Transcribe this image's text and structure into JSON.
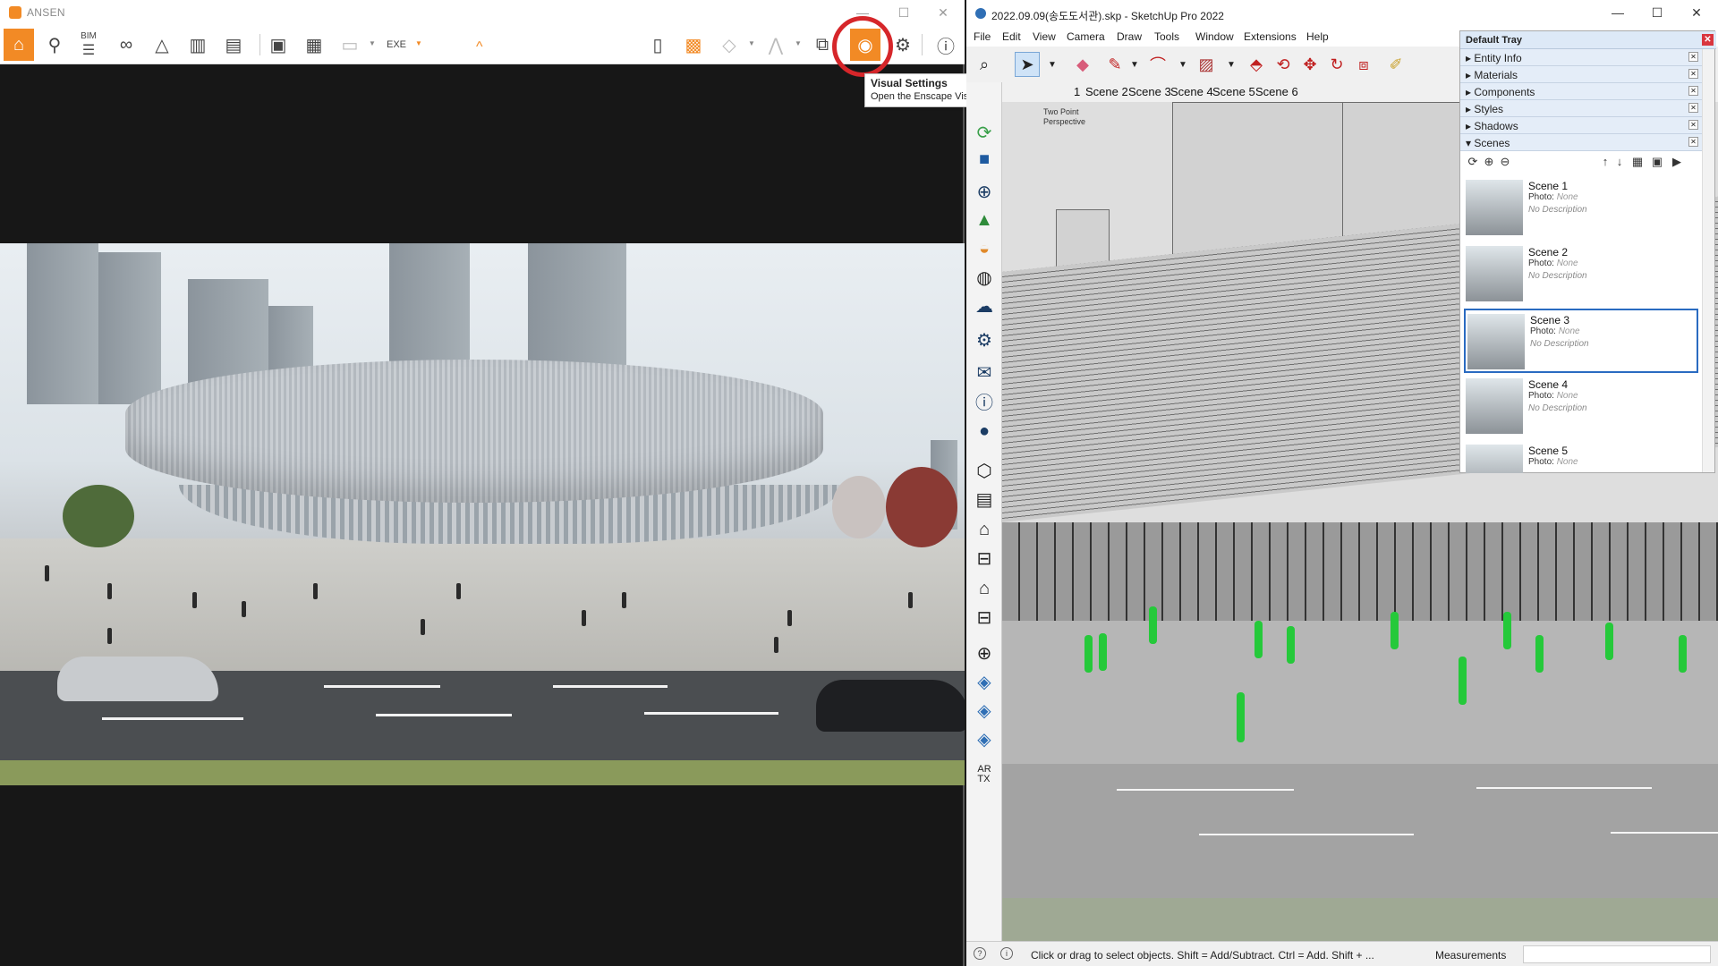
{
  "enscape": {
    "title": "ANSEN",
    "toolbar": {
      "bim_label": "BIM",
      "exe_label": "EXE",
      "collapse_glyph": "^"
    },
    "tooltip": {
      "title": "Visual Settings",
      "description": "Open the Enscape Visual Settings window"
    },
    "colors": {
      "accent": "#f28a25",
      "highlight_ring": "#d6262a"
    }
  },
  "sketchup": {
    "title": "2022.09.09(송도도서관).skp - SketchUp Pro 2022",
    "menu": [
      "File",
      "Edit",
      "View",
      "Camera",
      "Draw",
      "Tools",
      "Window",
      "Extensions",
      "Help"
    ],
    "scene_tabs": [
      "1",
      "Scene 2",
      "Scene 3",
      "Scene 4",
      "Scene 5",
      "Scene 6"
    ],
    "viewport_label_line1": "Two Point",
    "viewport_label_line2": "Perspective",
    "status_text": "Click or drag to select objects. Shift = Add/Subtract. Ctrl = Add. Shift + ...",
    "measurements_label": "Measurements",
    "lefttool_text": "AR\nTX"
  },
  "tray": {
    "title": "Default Tray",
    "sections": [
      "Entity Info",
      "Materials",
      "Components",
      "Styles",
      "Shadows",
      "Scenes"
    ],
    "scenes": [
      {
        "name": "Scene 1",
        "photo_label": "Photo:",
        "photo_value": "None",
        "description": "No Description",
        "selected": false
      },
      {
        "name": "Scene 2",
        "photo_label": "Photo:",
        "photo_value": "None",
        "description": "No Description",
        "selected": false
      },
      {
        "name": "Scene 3",
        "photo_label": "Photo:",
        "photo_value": "None",
        "description": "No Description",
        "selected": true
      },
      {
        "name": "Scene 4",
        "photo_label": "Photo:",
        "photo_value": "None",
        "description": "No Description",
        "selected": false
      },
      {
        "name": "Scene 5",
        "photo_label": "Photo:",
        "photo_value": "None",
        "description": "",
        "selected": false
      }
    ]
  }
}
